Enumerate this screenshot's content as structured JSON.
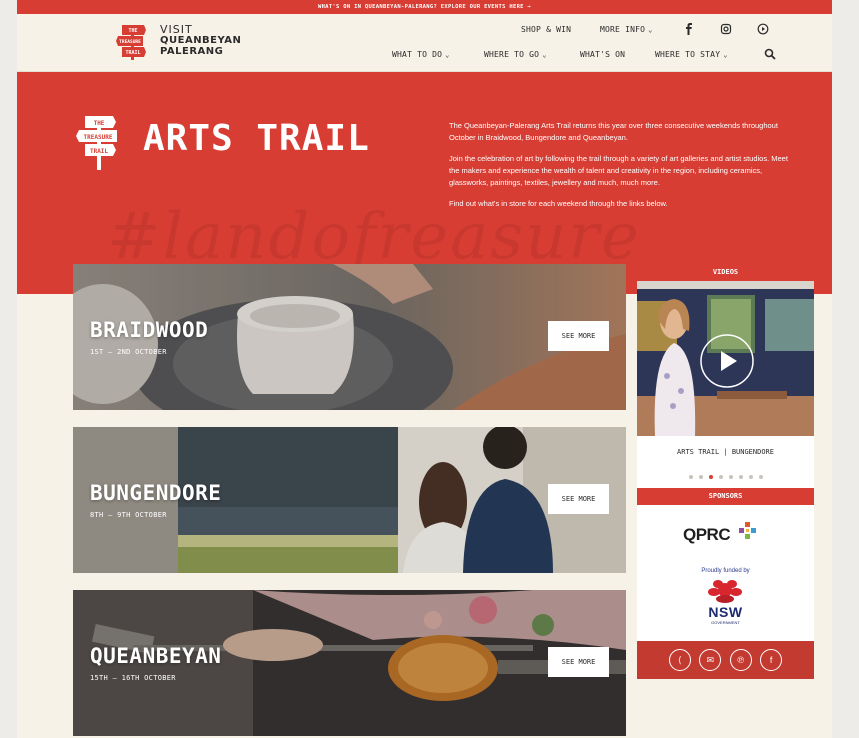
{
  "topbar": {
    "text": "WHAT'S ON IN QUEANBEYAN-PALERANG? EXPLORE OUR EVENTS HERE →"
  },
  "header": {
    "brand_visit": "VISIT",
    "brand_line1": "QUEANBEYAN",
    "brand_line2": "PALERANG",
    "top_links": [
      "SHOP & WIN",
      "MORE INFO"
    ],
    "nav": [
      "WHAT TO DO",
      "WHERE TO GO",
      "WHAT'S ON",
      "WHERE TO STAY"
    ],
    "logo_words": [
      "THE",
      "TREASURE",
      "TRAIL"
    ],
    "social_icons": [
      "facebook-icon",
      "instagram-icon",
      "youtube-icon"
    ]
  },
  "hero": {
    "title": "ARTS TRAIL",
    "logo_words": [
      "THE",
      "TREASURE",
      "TRAIL"
    ],
    "paragraphs": [
      "The Queanbeyan-Palerang Arts Trail returns this year over three consecutive weekends throughout October in Braidwood, Bungendore and Queanbeyan.",
      "Join the celebration of art by following the trail through a variety of art galleries and artist studios. Meet the makers and experience the wealth of talent and creativity in the region, including ceramics, glassworks, paintings, textiles, jewellery and much, much more.",
      "Find out what's in store for each weekend through the links below."
    ],
    "watermark": "#landofreasure"
  },
  "cards": [
    {
      "title": "BRAIDWOOD",
      "date": "1ST – 2ND OCTOBER",
      "button": "SEE MORE"
    },
    {
      "title": "BUNGENDORE",
      "date": "8TH – 9TH OCTOBER",
      "button": "SEE MORE"
    },
    {
      "title": "QUEANBEYAN",
      "date": "15TH – 16TH OCTOBER",
      "button": "SEE MORE"
    }
  ],
  "sidebar": {
    "videos_heading": "VIDEOS",
    "video_caption": "ARTS TRAIL | BUNGENDORE",
    "carousel": {
      "count": 8,
      "active": 2
    },
    "sponsors_heading": "SPONSORS",
    "qprc": "QPRC",
    "proudly": "Proudly funded by",
    "nsw": "NSW",
    "nsw_sub": "GOVERNMENT",
    "share_icons": [
      "share-icon",
      "email-icon",
      "pinterest-icon",
      "facebook-icon"
    ]
  },
  "colors": {
    "brand_red": "#d83d33",
    "cream": "#f7f2e8",
    "dark": "#2b2b2b"
  }
}
